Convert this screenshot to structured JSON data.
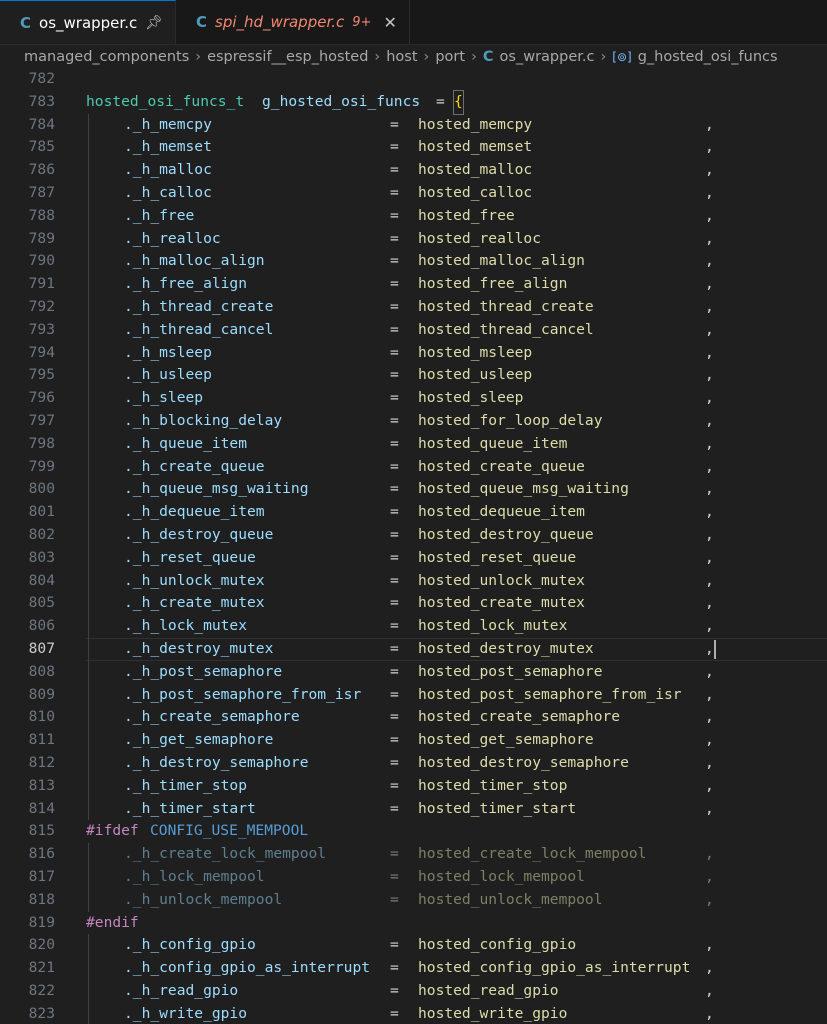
{
  "tabs": [
    {
      "icon": "C",
      "label": "os_wrapper.c",
      "pinned": true
    },
    {
      "icon": "C",
      "label": "spi_hd_wrapper.c",
      "badge": "9+",
      "close": "✕"
    }
  ],
  "breadcrumbs": [
    "managed_components",
    "espressif__esp_hosted",
    "host",
    "port",
    "os_wrapper.c",
    "g_hosted_osi_funcs"
  ],
  "code": {
    "first_line": "782",
    "decl_line": "783",
    "decl_type": "hosted_osi_funcs_t",
    "decl_name": "g_hosted_osi_funcs",
    "decl_op": "=",
    "decl_brace": "{",
    "ifdef_line": "815",
    "ifdef_kw": "#ifdef",
    "ifdef_macro": "CONFIG_USE_MEMPOOL",
    "endif_line": "819",
    "endif_kw": "#endif",
    "current_line": "807",
    "assignments": [
      {
        "ln": "784",
        "field": "._h_memcpy",
        "value": "hosted_memcpy"
      },
      {
        "ln": "785",
        "field": "._h_memset",
        "value": "hosted_memset"
      },
      {
        "ln": "786",
        "field": "._h_malloc",
        "value": "hosted_malloc"
      },
      {
        "ln": "787",
        "field": "._h_calloc",
        "value": "hosted_calloc"
      },
      {
        "ln": "788",
        "field": "._h_free",
        "value": "hosted_free"
      },
      {
        "ln": "789",
        "field": "._h_realloc",
        "value": "hosted_realloc"
      },
      {
        "ln": "790",
        "field": "._h_malloc_align",
        "value": "hosted_malloc_align"
      },
      {
        "ln": "791",
        "field": "._h_free_align",
        "value": "hosted_free_align"
      },
      {
        "ln": "792",
        "field": "._h_thread_create",
        "value": "hosted_thread_create"
      },
      {
        "ln": "793",
        "field": "._h_thread_cancel",
        "value": "hosted_thread_cancel"
      },
      {
        "ln": "794",
        "field": "._h_msleep",
        "value": "hosted_msleep"
      },
      {
        "ln": "795",
        "field": "._h_usleep",
        "value": "hosted_usleep"
      },
      {
        "ln": "796",
        "field": "._h_sleep",
        "value": "hosted_sleep"
      },
      {
        "ln": "797",
        "field": "._h_blocking_delay",
        "value": "hosted_for_loop_delay"
      },
      {
        "ln": "798",
        "field": "._h_queue_item",
        "value": "hosted_queue_item"
      },
      {
        "ln": "799",
        "field": "._h_create_queue",
        "value": "hosted_create_queue"
      },
      {
        "ln": "800",
        "field": "._h_queue_msg_waiting",
        "value": "hosted_queue_msg_waiting"
      },
      {
        "ln": "801",
        "field": "._h_dequeue_item",
        "value": "hosted_dequeue_item"
      },
      {
        "ln": "802",
        "field": "._h_destroy_queue",
        "value": "hosted_destroy_queue"
      },
      {
        "ln": "803",
        "field": "._h_reset_queue",
        "value": "hosted_reset_queue"
      },
      {
        "ln": "804",
        "field": "._h_unlock_mutex",
        "value": "hosted_unlock_mutex"
      },
      {
        "ln": "805",
        "field": "._h_create_mutex",
        "value": "hosted_create_mutex"
      },
      {
        "ln": "806",
        "field": "._h_lock_mutex",
        "value": "hosted_lock_mutex"
      },
      {
        "ln": "807",
        "field": "._h_destroy_mutex",
        "value": "hosted_destroy_mutex"
      },
      {
        "ln": "808",
        "field": "._h_post_semaphore",
        "value": "hosted_post_semaphore"
      },
      {
        "ln": "809",
        "field": "._h_post_semaphore_from_isr",
        "value": "hosted_post_semaphore_from_isr"
      },
      {
        "ln": "810",
        "field": "._h_create_semaphore",
        "value": "hosted_create_semaphore"
      },
      {
        "ln": "811",
        "field": "._h_get_semaphore",
        "value": "hosted_get_semaphore"
      },
      {
        "ln": "812",
        "field": "._h_destroy_semaphore",
        "value": "hosted_destroy_semaphore"
      },
      {
        "ln": "813",
        "field": "._h_timer_stop",
        "value": "hosted_timer_stop"
      },
      {
        "ln": "814",
        "field": "._h_timer_start",
        "value": "hosted_timer_start"
      }
    ],
    "mempool": [
      {
        "ln": "816",
        "field": "._h_create_lock_mempool",
        "value": "hosted_create_lock_mempool"
      },
      {
        "ln": "817",
        "field": "._h_lock_mempool",
        "value": "hosted_lock_mempool"
      },
      {
        "ln": "818",
        "field": "._h_unlock_mempool",
        "value": "hosted_unlock_mempool"
      }
    ],
    "gpio": [
      {
        "ln": "820",
        "field": "._h_config_gpio",
        "value": "hosted_config_gpio"
      },
      {
        "ln": "821",
        "field": "._h_config_gpio_as_interrupt",
        "value": "hosted_config_gpio_as_interrupt"
      },
      {
        "ln": "822",
        "field": "._h_read_gpio",
        "value": "hosted_read_gpio"
      },
      {
        "ln": "823",
        "field": "._h_write_gpio",
        "value": "hosted_write_gpio"
      }
    ]
  }
}
